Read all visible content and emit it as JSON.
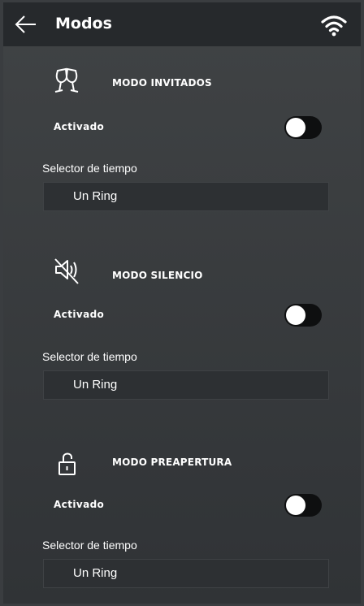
{
  "header": {
    "title": "Modos",
    "back_icon": "arrow-left-icon",
    "wifi_icon": "wifi-icon"
  },
  "sections": [
    {
      "icon": "champagne-glasses-icon",
      "title": "MODO INVITADOS",
      "activated_label": "Activado",
      "toggle_on": false,
      "selector_label": "Selector de tiempo",
      "selector_value": "Un Ring"
    },
    {
      "icon": "speaker-muted-icon",
      "title": "MODO SILENCIO",
      "activated_label": "Activado",
      "toggle_on": false,
      "selector_label": "Selector de tiempo",
      "selector_value": "Un Ring"
    },
    {
      "icon": "unlocked-padlock-icon",
      "title": "MODO PREAPERTURA",
      "activated_label": "Activado",
      "toggle_on": false,
      "selector_label": "Selector de tiempo",
      "selector_value": "Un Ring"
    }
  ],
  "colors": {
    "background": "#3a3d40",
    "topbar": "#26292c",
    "toggle_track": "#0e0f10",
    "toggle_knob": "#ffffff",
    "select_box": "#2d3033"
  }
}
